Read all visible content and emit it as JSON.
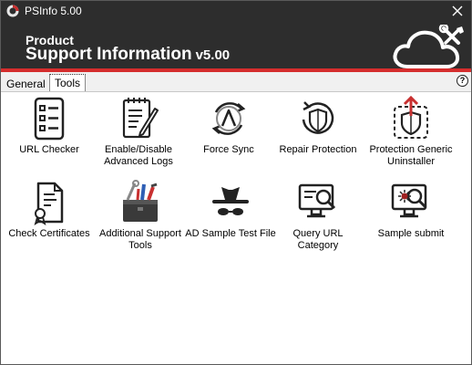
{
  "window": {
    "title": "PSInfo 5.00"
  },
  "banner": {
    "line1": "Product",
    "line2": "Support Information",
    "version": "v5.00"
  },
  "tabs": [
    {
      "label": "General"
    },
    {
      "label": "Tools"
    }
  ],
  "help": {
    "label": "?"
  },
  "tools": [
    {
      "label": "URL Checker"
    },
    {
      "label": "Enable/Disable Advanced Logs"
    },
    {
      "label": "Force Sync"
    },
    {
      "label": "Repair Protection"
    },
    {
      "label": "Protection Generic Uninstaller"
    },
    {
      "label": "Check Certificates"
    },
    {
      "label": "Additional Support Tools"
    },
    {
      "label": "AD Sample Test File"
    },
    {
      "label": "Query URL Category"
    },
    {
      "label": "Sample submit"
    }
  ],
  "colors": {
    "titlebar": "#2d2d2d",
    "accent_red": "#d52d2d",
    "panel": "#ffffff"
  }
}
